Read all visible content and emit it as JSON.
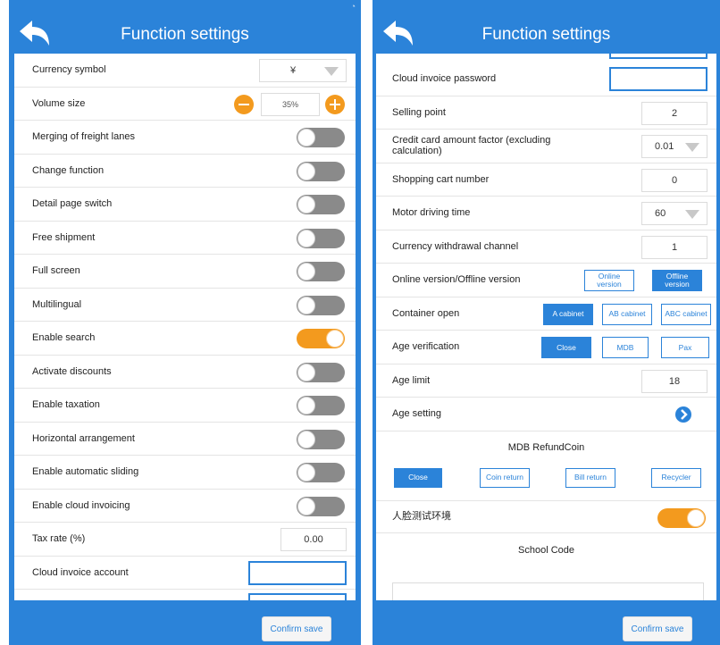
{
  "left": {
    "title": "Function settings",
    "currency_symbol": {
      "label": "Currency symbol",
      "value": "¥"
    },
    "volume_size": {
      "label": "Volume size",
      "value": "35%"
    },
    "toggles": [
      {
        "label": "Merging of freight lanes",
        "on": false
      },
      {
        "label": "Change function",
        "on": false
      },
      {
        "label": "Detail page switch",
        "on": false
      },
      {
        "label": "Free shipment",
        "on": false
      },
      {
        "label": "Full screen",
        "on": false
      },
      {
        "label": "Multilingual",
        "on": false
      },
      {
        "label": "Enable search",
        "on": true
      },
      {
        "label": "Activate discounts",
        "on": false
      },
      {
        "label": "Enable taxation",
        "on": false
      },
      {
        "label": "Horizontal arrangement",
        "on": false
      },
      {
        "label": "Enable automatic sliding",
        "on": false
      },
      {
        "label": "Enable cloud invoicing",
        "on": false
      }
    ],
    "tax_rate": {
      "label": "Tax rate (%)",
      "value": "0.00"
    },
    "cloud_invoice_account": {
      "label": "Cloud invoice account",
      "value": ""
    },
    "confirm_label": "Confirm save"
  },
  "right": {
    "title": "Function settings",
    "cloud_invoice_password": {
      "label": "Cloud invoice password",
      "value": ""
    },
    "selling_point": {
      "label": "Selling point",
      "value": "2"
    },
    "credit_card_factor": {
      "label": "Credit card amount factor (excluding calculation)",
      "value": "0.01"
    },
    "shopping_cart_number": {
      "label": "Shopping cart number",
      "value": "0"
    },
    "motor_driving_time": {
      "label": "Motor driving time",
      "value": "60"
    },
    "currency_withdrawal_channel": {
      "label": "Currency withdrawal channel",
      "value": "1"
    },
    "online_offline": {
      "label": "Online version/Offline version",
      "options": [
        "Online version",
        "Offline version"
      ],
      "selected": 1
    },
    "container_open": {
      "label": "Container open",
      "options": [
        "A cabinet",
        "AB cabinet",
        "ABC cabinet"
      ],
      "selected": 0
    },
    "age_verification": {
      "label": "Age verification",
      "options": [
        "Close",
        "MDB",
        "Pax"
      ],
      "selected": 0
    },
    "age_limit": {
      "label": "Age limit",
      "value": "18"
    },
    "age_setting": {
      "label": "Age setting"
    },
    "mdb_refund": {
      "label": "MDB RefundCoin",
      "options": [
        "Close",
        "Coin return",
        "Bill return",
        "Recycler"
      ],
      "selected": 0
    },
    "face_test": {
      "label": "人脸测试环境",
      "on": true
    },
    "school_code": {
      "label": "School Code",
      "value": ""
    },
    "confirm_label": "Confirm save"
  },
  "icons": {
    "back": "back-arrow-icon",
    "wifi": "wifi-icon",
    "chevron": "chevron-right-icon"
  },
  "colors": {
    "primary": "#2b83d9",
    "accent": "#f39a1e",
    "toggle_off": "#8a8a8a"
  }
}
